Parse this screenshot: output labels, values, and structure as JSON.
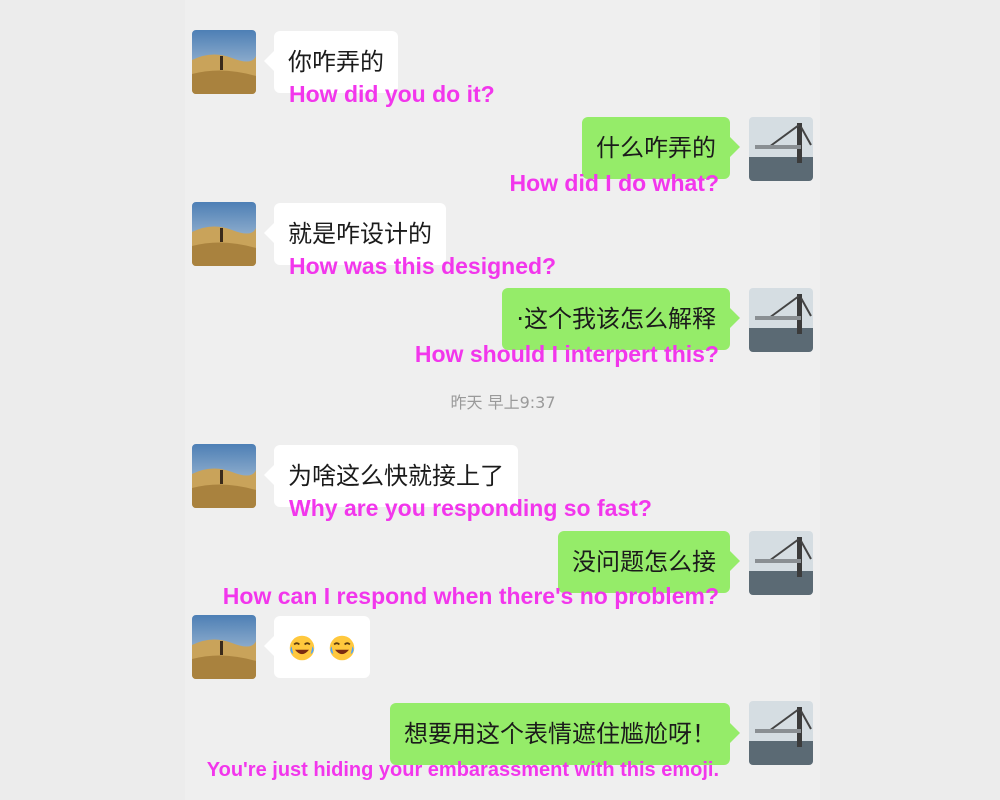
{
  "timestamp": "昨天 早上9:37",
  "messages": [
    {
      "text": "你咋弄的",
      "translation": "How did you do it?"
    },
    {
      "text": "什么咋弄的",
      "translation": "How did I do what?"
    },
    {
      "text": "就是咋设计的",
      "translation": "How was this designed?"
    },
    {
      "text": "·这个我该怎么解释",
      "translation": "How should I interpert this?"
    },
    {
      "text": "为啥这么快就接上了",
      "translation": "Why are you responding so fast?"
    },
    {
      "text": "没问题怎么接",
      "translation": "How can I respond when there's no problem?"
    },
    {
      "emoji": "laughing-crying-emoji x2"
    },
    {
      "text": "想要用这个表情遮住尴尬呀！",
      "translation": "You're just hiding your embarassment with this emoji."
    }
  ],
  "colors": {
    "incoming_bubble": "#ffffff",
    "outgoing_bubble": "#95ec69",
    "translation": "#f236ec",
    "background": "#efefef"
  }
}
